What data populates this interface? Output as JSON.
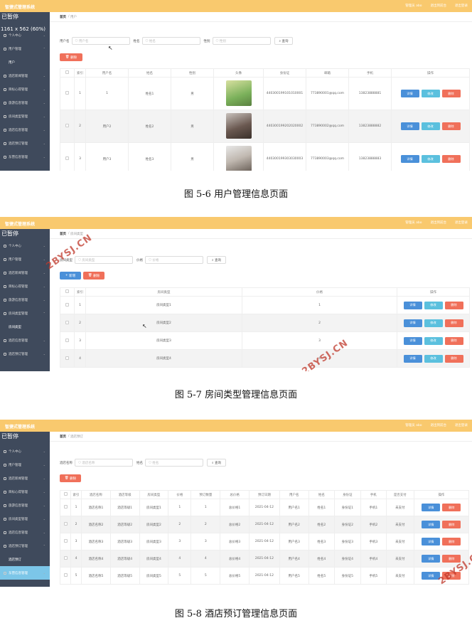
{
  "app": {
    "system_title": "智捷式管理系统",
    "header_links": [
      "管理员 abo",
      "退出到前台",
      "退出登录"
    ],
    "overlay_title": "已暂停",
    "overlay_resolution": "1161 x 562 (60%)"
  },
  "menu": {
    "personal": "个人中心",
    "user_mgmt": "用户管理",
    "user_sub": "用户",
    "news": "酒店新闻管理",
    "hotel_info": "目标心得管理",
    "travel": "旅游信息管理",
    "room_type": "房间类型管理",
    "room_type_sub": "房间类型",
    "hotel_mgmt": "酒店信息管理",
    "booking": "酒店预订管理",
    "booking_sub": "酒店预订",
    "cancel": "东营信息管理"
  },
  "common": {
    "breadcrumb_home": "首页",
    "search_btn": "查询",
    "delete_btn": "删除",
    "add_btn": "新增",
    "detail_btn": "详情",
    "edit_btn": "修改"
  },
  "fig1": {
    "breadcrumb": "用户",
    "search": {
      "label_user": "用户名",
      "ph_user": "用户名",
      "label_name": "姓名",
      "ph_name": "姓名",
      "label_gender": "性别",
      "ph_gender": "性别"
    },
    "headers": [
      "索引",
      "用户名",
      "姓名",
      "性别",
      "头像",
      "身份证",
      "邮箱",
      "手机",
      "操作"
    ],
    "rows": [
      {
        "idx": "1",
        "user": "1",
        "name": "姓名1",
        "gender": "男",
        "id": "440300199101010001",
        "email": "773890001@qq.com",
        "phone": "13823888881"
      },
      {
        "idx": "2",
        "user": "用户2",
        "name": "姓名2",
        "gender": "男",
        "id": "440300199202020002",
        "email": "773890002@qq.com",
        "phone": "13823888882"
      },
      {
        "idx": "3",
        "user": "用户3",
        "name": "姓名3",
        "gender": "男",
        "id": "440300199303030003",
        "email": "773890003@qq.com",
        "phone": "13823888883"
      }
    ],
    "caption": "图 5-6 用户管理信息页面"
  },
  "fig2": {
    "breadcrumb": "房间类型",
    "search": {
      "label_type": "房间类型",
      "ph_type": "房间类型",
      "label_price": "价格",
      "ph_price": "价格"
    },
    "headers": [
      "索引",
      "房间类型",
      "价格",
      "操作"
    ],
    "rows": [
      {
        "idx": "1",
        "type": "房间类型1",
        "price": "1"
      },
      {
        "idx": "2",
        "type": "房间类型2",
        "price": "2"
      },
      {
        "idx": "3",
        "type": "房间类型3",
        "price": "3"
      },
      {
        "idx": "4",
        "type": "房间类型4",
        "price": "4"
      }
    ],
    "caption": "图 5-7 房间类型管理信息页面"
  },
  "fig3": {
    "breadcrumb": "酒店预订",
    "search": {
      "label_hotel": "酒店名称",
      "ph_hotel": "酒店名称",
      "label_name": "姓名",
      "ph_name": "姓名"
    },
    "headers": [
      "索引",
      "酒店名称",
      "酒店等级",
      "房间类型",
      "价格",
      "预订数量",
      "总价格",
      "预订日期",
      "用户名",
      "姓名",
      "身份证",
      "手机",
      "是否支付",
      "操作"
    ],
    "rows": [
      {
        "idx": "1",
        "hotel": "酒店名称1",
        "level": "酒店等级1",
        "room": "房间类型1",
        "price": "1",
        "qty": "1",
        "total": "总价格1",
        "date": "2021-04-12",
        "user": "用户名1",
        "name": "姓名1",
        "idcard": "身份证1",
        "phone": "手机1",
        "paid": "未支付"
      },
      {
        "idx": "2",
        "hotel": "酒店名称2",
        "level": "酒店等级2",
        "room": "房间类型2",
        "price": "2",
        "qty": "2",
        "total": "总价格2",
        "date": "2021-04-12",
        "user": "用户名2",
        "name": "姓名2",
        "idcard": "身份证2",
        "phone": "手机2",
        "paid": "未支付"
      },
      {
        "idx": "3",
        "hotel": "酒店名称3",
        "level": "酒店等级3",
        "room": "房间类型3",
        "price": "3",
        "qty": "3",
        "total": "总价格3",
        "date": "2021-04-12",
        "user": "用户名3",
        "name": "姓名3",
        "idcard": "身份证3",
        "phone": "手机3",
        "paid": "未支付"
      },
      {
        "idx": "4",
        "hotel": "酒店名称4",
        "level": "酒店等级4",
        "room": "房间类型4",
        "price": "4",
        "qty": "4",
        "total": "总价格4",
        "date": "2021-04-12",
        "user": "用户名4",
        "name": "姓名4",
        "idcard": "身份证4",
        "phone": "手机4",
        "paid": "未支付"
      },
      {
        "idx": "5",
        "hotel": "酒店名称5",
        "level": "酒店等级5",
        "room": "房间类型5",
        "price": "5",
        "qty": "5",
        "total": "总价格5",
        "date": "2021-04-12",
        "user": "用户名5",
        "name": "姓名5",
        "idcard": "身份证5",
        "phone": "手机5",
        "paid": "未支付"
      }
    ],
    "caption": "图 5-8 酒店预订管理信息页面"
  },
  "watermark": "2BYSJ.CN"
}
